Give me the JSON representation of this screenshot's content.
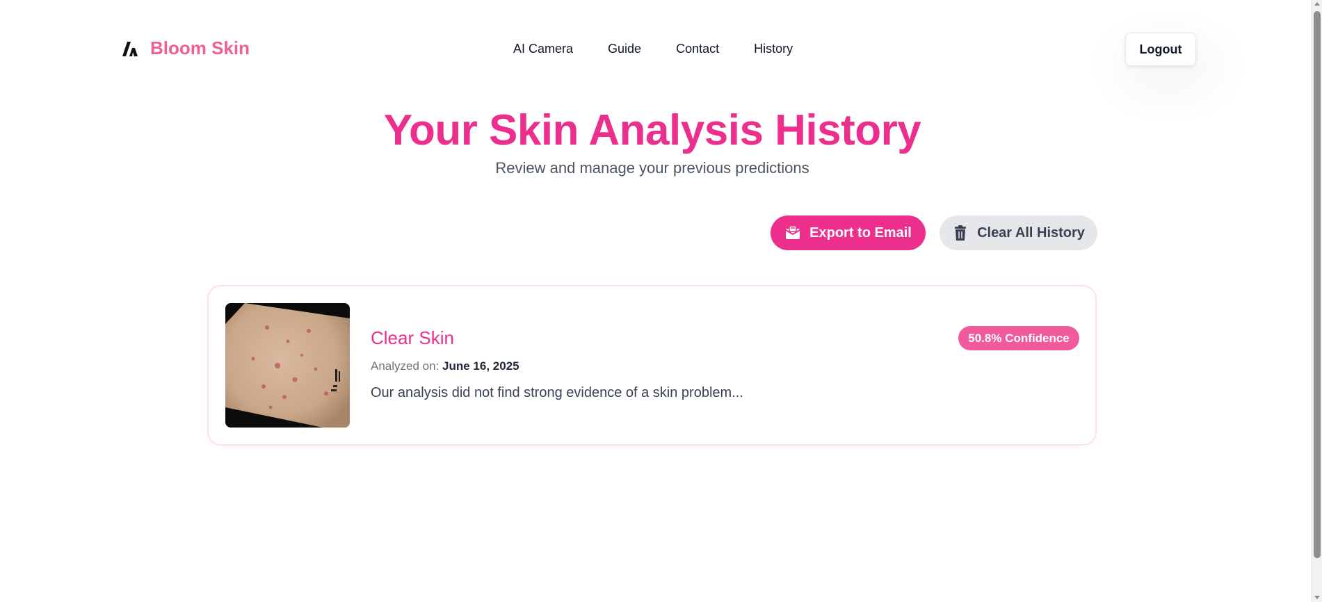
{
  "brand": {
    "name": "Bloom Skin",
    "icon": "bloom-logo-icon",
    "color": "#f0608f"
  },
  "nav": {
    "items": [
      {
        "label": "AI Camera"
      },
      {
        "label": "Guide"
      },
      {
        "label": "Contact"
      },
      {
        "label": "History"
      }
    ],
    "logout_label": "Logout"
  },
  "hero": {
    "title": "Your Skin Analysis History",
    "subtitle": "Review and manage your previous predictions"
  },
  "actions": {
    "export": {
      "label": "Export to Email",
      "icon": "email-export-icon",
      "color": "#ec2f8c"
    },
    "clear": {
      "label": "Clear All History",
      "icon": "trash-icon",
      "color": "#e5e7eb"
    }
  },
  "history": [
    {
      "condition": "Clear Skin",
      "analyzed_label": "Analyzed on:",
      "date": "June 16, 2025",
      "description": "Our analysis did not find strong evidence of a skin problem...",
      "confidence": "50.8% Confidence",
      "image": "skin-photo-thumbnail"
    }
  ],
  "colors": {
    "accent": "#ec2f8c",
    "badge": "#f15b9d"
  }
}
